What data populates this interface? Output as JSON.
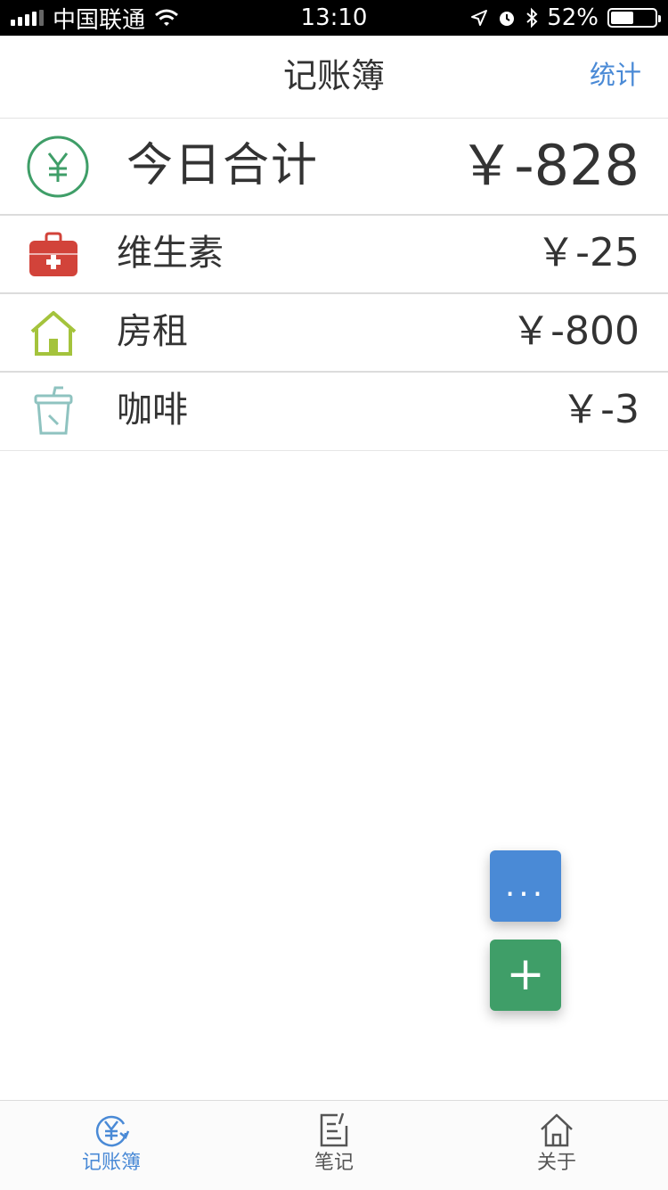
{
  "status_bar": {
    "carrier": "中国联通",
    "time": "13:10",
    "battery_text": "52%",
    "battery_level": 0.52
  },
  "nav": {
    "title": "记账簿",
    "action_label": "统计"
  },
  "summary": {
    "label": "今日合计",
    "amount": "￥-828"
  },
  "entries": [
    {
      "label": "维生素",
      "amount": "￥-25",
      "icon": "medkit-icon",
      "color": "#d2433a"
    },
    {
      "label": "房租",
      "amount": "￥-800",
      "icon": "house-icon",
      "color": "#a4c33c"
    },
    {
      "label": "咖啡",
      "amount": "￥-3",
      "icon": "cup-icon",
      "color": "#8fc3c0"
    }
  ],
  "fabs": {
    "more_label": "...",
    "add_label": "+"
  },
  "tabs": [
    {
      "label": "记账簿",
      "icon": "yuan-refresh-icon",
      "active": true
    },
    {
      "label": "笔记",
      "icon": "note-edit-icon",
      "active": false
    },
    {
      "label": "关于",
      "icon": "home-icon",
      "active": false
    }
  ],
  "colors": {
    "accent_blue": "#4a8ad6",
    "accent_green": "#3f9e68",
    "text": "#333333"
  }
}
